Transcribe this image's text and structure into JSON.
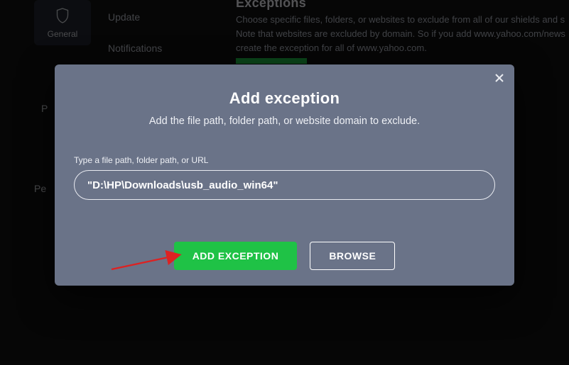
{
  "bg": {
    "tile_label": "General",
    "nav": {
      "update": "Update",
      "notifications": "Notifications"
    },
    "side": {
      "p1": "P",
      "p2": "Pe"
    },
    "exceptions_title": "Exceptions",
    "exceptions_para_l1": "Choose specific files, folders, or websites to exclude from all of our shields and s",
    "exceptions_para_l2": "Note that websites are excluded by domain. So if you add www.yahoo.com/news",
    "exceptions_para_l3": "create the exception for all of www.yahoo.com."
  },
  "modal": {
    "title": "Add exception",
    "subtitle": "Add the file path, folder path, or website domain to exclude.",
    "field_label": "Type a file path, folder path, or URL",
    "path_value": "\"D:\\HP\\Downloads\\usb_audio_win64\"",
    "add_button": "ADD EXCEPTION",
    "browse_button": "BROWSE"
  },
  "colors": {
    "accent_green": "#1fc246",
    "modal_bg": "#6a7388"
  }
}
